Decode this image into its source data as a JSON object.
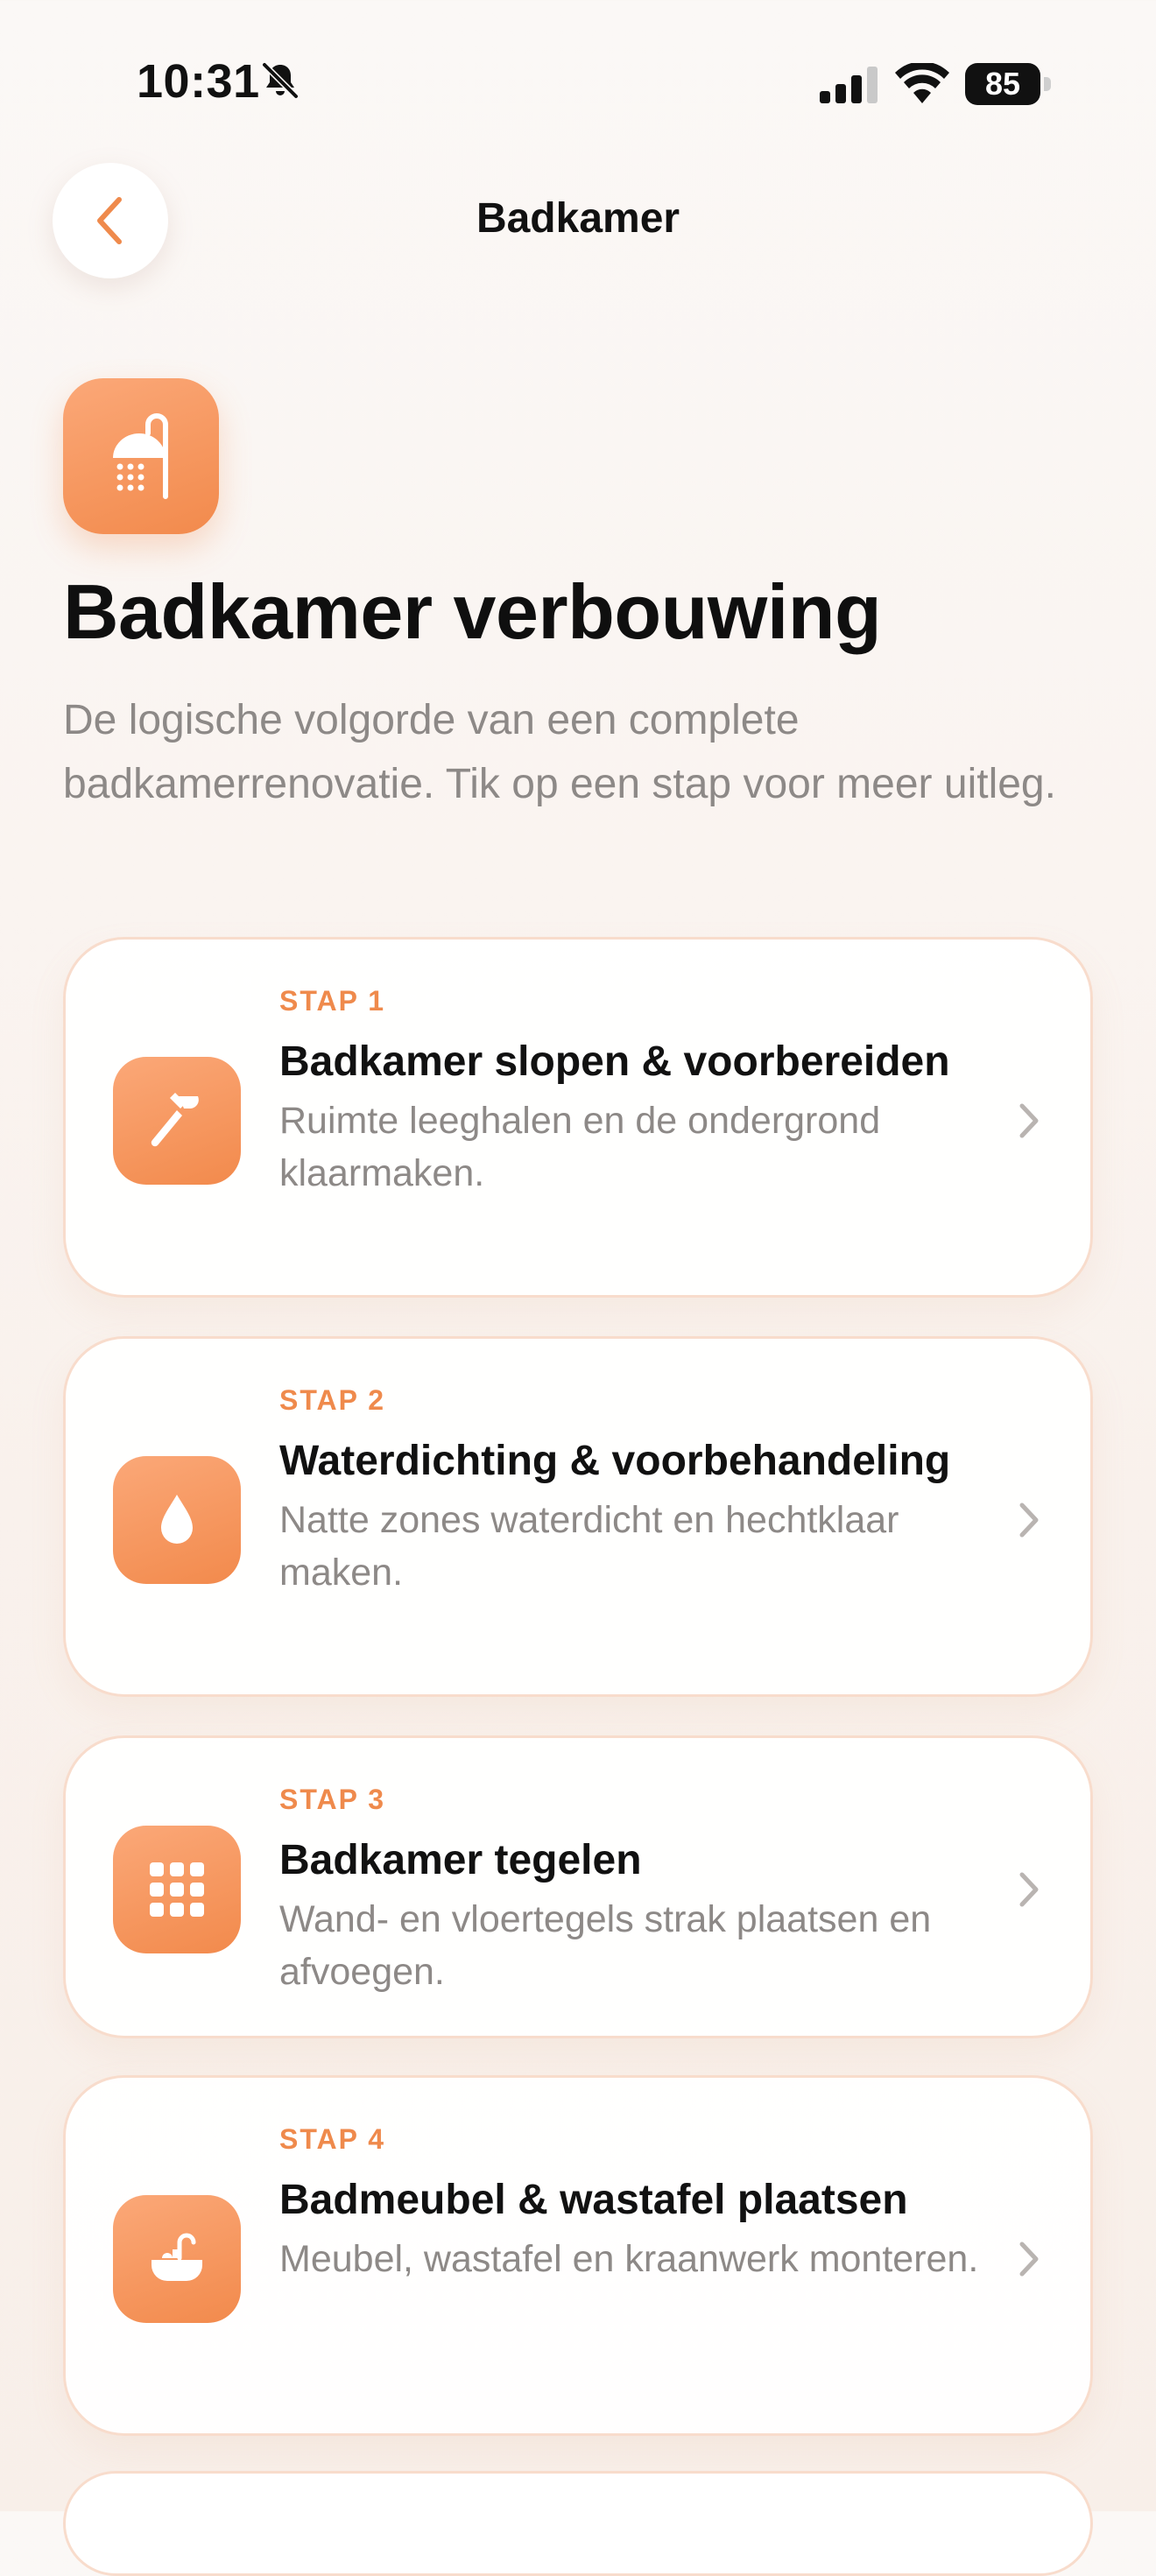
{
  "status_bar": {
    "time": "10:31",
    "battery": "85",
    "battery_level": 0.85,
    "icons": [
      "bell-slash-icon",
      "signal-icon",
      "wifi-icon",
      "battery-icon"
    ]
  },
  "nav": {
    "title": "Badkamer",
    "back_icon": "chevron-left-icon"
  },
  "header": {
    "icon": "shower-icon",
    "title": "Badkamer verbouwing",
    "description": "De logische volgorde van een complete badkamerrenovatie. Tik op een stap voor meer uitleg."
  },
  "steps": [
    {
      "step": "STAP 1",
      "title": "Badkamer slopen & voorbereiden",
      "description": "Ruimte leeghalen en de ondergrond klaarmaken.",
      "icon": "hammer-icon"
    },
    {
      "step": "STAP 2",
      "title": "Waterdichting & voorbehandeling",
      "description": "Natte zones waterdicht en hechtklaar maken.",
      "icon": "drop-icon"
    },
    {
      "step": "STAP 3",
      "title": "Badkamer tegelen",
      "description": "Wand- en vloertegels strak plaatsen en afvoegen.",
      "icon": "tiles-grid-icon"
    },
    {
      "step": "STAP 4",
      "title": "Badmeubel & wastafel plaatsen",
      "description": "Meubel, wastafel en kraanwerk monteren.",
      "icon": "sink-icon"
    }
  ],
  "colors": {
    "accent": "#ef8a4c",
    "accent_light": "#fba878",
    "text": "#111111",
    "muted": "#8d8987",
    "card_border": "#f8dccc"
  }
}
